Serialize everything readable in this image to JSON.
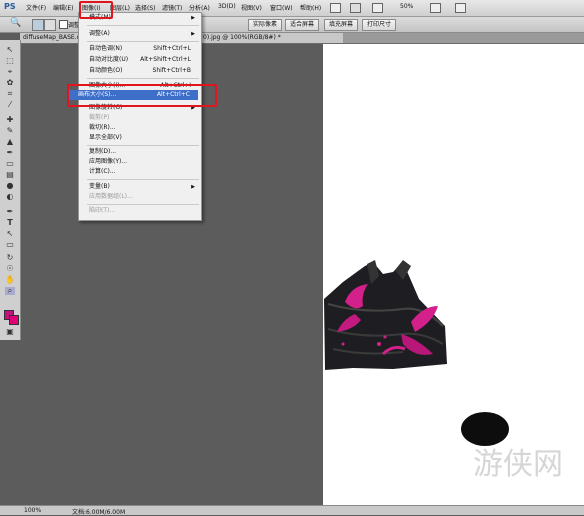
{
  "menubar": {
    "logo": "PS",
    "items": [
      "文件(F)",
      "编辑(E)",
      "图像(I)",
      "图层(L)",
      "选择(S)",
      "滤镜(T)",
      "分析(A)",
      "3D(D)",
      "视图(V)",
      "窗口(W)",
      "帮助(H)"
    ],
    "zoom": "50%"
  },
  "options": {
    "resize_label": "调整",
    "actual_pixels": "实际像素",
    "fit_screen": "适合屏幕",
    "fill_screen": "填充屏幕",
    "print_size": "打印尺寸"
  },
  "document": {
    "tab_name": "diffuseMap_BASE.d",
    "tab_info": "0).jpg @ 100%(RGB/8#) *"
  },
  "status": {
    "zoom": "100%",
    "doc_info": "文档:6.00M/6.00M"
  },
  "menu_image": {
    "items": [
      {
        "label": "模式(M)",
        "shortcut": "",
        "submenu": true,
        "disabled": false
      },
      {
        "label": "调整(A)",
        "shortcut": "",
        "submenu": true,
        "disabled": false
      },
      {
        "label": "自动色调(N)",
        "shortcut": "Shift+Ctrl+L",
        "submenu": false,
        "disabled": false
      },
      {
        "label": "自动对比度(U)",
        "shortcut": "Alt+Shift+Ctrl+L",
        "submenu": false,
        "disabled": false
      },
      {
        "label": "自动颜色(O)",
        "shortcut": "Shift+Ctrl+B",
        "submenu": false,
        "disabled": false
      },
      {
        "label": "图像大小(I)...",
        "shortcut": "Alt+Ctrl+I",
        "submenu": false,
        "disabled": false
      },
      {
        "label": "画布大小(S)...",
        "shortcut": "Alt+Ctrl+C",
        "submenu": false,
        "disabled": false
      },
      {
        "label": "图像旋转(G)",
        "shortcut": "",
        "submenu": true,
        "disabled": false
      },
      {
        "label": "裁剪(P)",
        "shortcut": "",
        "submenu": false,
        "disabled": true
      },
      {
        "label": "裁切(R)...",
        "shortcut": "",
        "submenu": false,
        "disabled": false
      },
      {
        "label": "显示全部(V)",
        "shortcut": "",
        "submenu": false,
        "disabled": false
      },
      {
        "label": "复制(D)...",
        "shortcut": "",
        "submenu": false,
        "disabled": false
      },
      {
        "label": "应用图像(Y)...",
        "shortcut": "",
        "submenu": false,
        "disabled": false
      },
      {
        "label": "计算(C)...",
        "shortcut": "",
        "submenu": false,
        "disabled": false
      },
      {
        "label": "变量(B)",
        "shortcut": "",
        "submenu": true,
        "disabled": false
      },
      {
        "label": "应用数据组(L)...",
        "shortcut": "",
        "submenu": false,
        "disabled": true
      },
      {
        "label": "陷印(T)...",
        "shortcut": "",
        "submenu": false,
        "disabled": true
      }
    ]
  },
  "colors": {
    "highlight": "#3d6fc9",
    "annotation": "#e0151e",
    "foreground": "#c0137e",
    "background": "#e0007a"
  },
  "watermark": "游侠网"
}
